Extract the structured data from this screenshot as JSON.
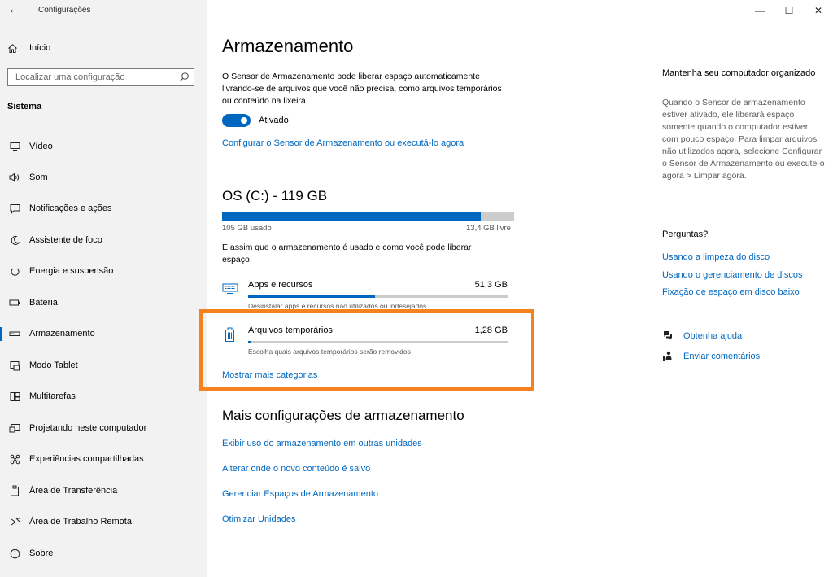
{
  "window": {
    "title": "Configurações",
    "controls": {
      "minimize": "—",
      "maximize": "☐",
      "close": "✕"
    }
  },
  "sidebar": {
    "home_label": "Início",
    "search_placeholder": "Localizar uma configuração",
    "section_title": "Sistema",
    "items": [
      {
        "label": "Vídeo",
        "icon": "monitor-icon"
      },
      {
        "label": "Som",
        "icon": "speaker-icon"
      },
      {
        "label": "Notificações e ações",
        "icon": "notification-icon"
      },
      {
        "label": "Assistente de foco",
        "icon": "moon-icon"
      },
      {
        "label": "Energia e suspensão",
        "icon": "power-icon"
      },
      {
        "label": "Bateria",
        "icon": "battery-icon"
      },
      {
        "label": "Armazenamento",
        "icon": "storage-icon",
        "active": true
      },
      {
        "label": "Modo Tablet",
        "icon": "tablet-mode-icon"
      },
      {
        "label": "Multitarefas",
        "icon": "multitasking-icon"
      },
      {
        "label": "Projetando neste computador",
        "icon": "projecting-icon"
      },
      {
        "label": "Experiências compartilhadas",
        "icon": "shared-experiences-icon"
      },
      {
        "label": "Área de Transferência",
        "icon": "clipboard-icon"
      },
      {
        "label": "Área de Trabalho Remota",
        "icon": "remote-desktop-icon"
      },
      {
        "label": "Sobre",
        "icon": "info-icon"
      }
    ]
  },
  "main": {
    "title": "Armazenamento",
    "sense_description": "O Sensor de Armazenamento pode liberar espaço automaticamente livrando-se de arquivos que você não precisa, como arquivos temporários ou conteúdo na lixeira.",
    "toggle_label": "Ativado",
    "toggle_on": true,
    "configure_link": "Configurar o Sensor de Armazenamento ou executá-lo agora",
    "drive": {
      "title": "OS (C:) - 119 GB",
      "used_label": "105 GB usado",
      "free_label": "13,4 GB livre",
      "used_fraction": 0.887
    },
    "usage_description": "É assim que o armazenamento é usado e como você pode liberar espaço.",
    "categories": [
      {
        "title": "Apps e recursos",
        "size": "51,3 GB",
        "desc": "Desinstalar apps e recursos não utilizados ou indesejados",
        "fraction": 0.49,
        "icon": "apps-icon"
      },
      {
        "title": "Arquivos temporários",
        "size": "1,28 GB",
        "desc": "Escolha quais arquivos temporários serão removidos",
        "fraction": 0.012,
        "icon": "trash-icon"
      }
    ],
    "show_more_link": "Mostrar mais categorias",
    "more_title": "Mais configurações de armazenamento",
    "more_links": [
      "Exibir uso do armazenamento em outras unidades",
      "Alterar onde o novo conteúdo é salvo",
      "Gerenciar Espaços de Armazenamento",
      "Otimizar Unidades"
    ]
  },
  "right": {
    "title": "Mantenha seu computador organizado",
    "text": "Quando o Sensor de armazenamento estiver ativado, ele liberará espaço somente quando o computador estiver com pouco espaço. Para limpar arquivos não utilizados agora, selecione Configurar o Sensor de Armazenamento ou execute-o agora > Limpar agora.",
    "questions_title": "Perguntas?",
    "question_links": [
      "Usando a limpeza do disco",
      "Usando o gerenciamento de discos",
      "Fixação de espaço em disco baixo"
    ],
    "help_label": "Obtenha ajuda",
    "feedback_label": "Enviar comentários"
  },
  "colors": {
    "accent": "#0067c0",
    "highlight": "#f5821f",
    "sidebar_bg": "#f2f2f2"
  }
}
